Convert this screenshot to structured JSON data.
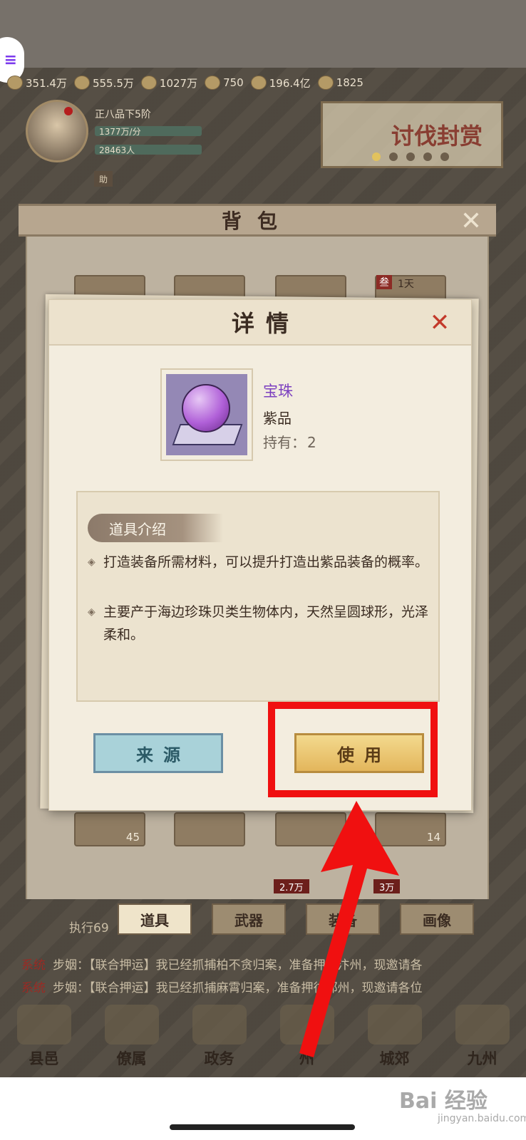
{
  "resources": [
    {
      "icon": "coin-icon",
      "value": "351.4万"
    },
    {
      "icon": "grain-icon",
      "value": "555.5万"
    },
    {
      "icon": "soldier-icon",
      "value": "1027万"
    },
    {
      "icon": "gold-icon",
      "value": "750"
    },
    {
      "icon": "copper-coin-icon",
      "value": "196.4亿"
    },
    {
      "icon": "fame-icon",
      "value": "1825"
    }
  ],
  "player": {
    "rank": "正八品下5阶",
    "income": "1377万/分",
    "population": "28463人",
    "assist_label": "助"
  },
  "event_banner": {
    "text": "讨伐封赏"
  },
  "bag": {
    "title": "背包",
    "slot_tag": "叁",
    "slot_tag_extra": "1天",
    "counts": [
      "45",
      "14"
    ],
    "prices": [
      "2.7万",
      "3万"
    ],
    "tabs": [
      "道具",
      "武器",
      "装备",
      "画像"
    ],
    "exec_text": "执行69"
  },
  "dialog": {
    "title": "详情",
    "item": {
      "name": "宝珠",
      "grade": "紫品",
      "owned_label": "持有：",
      "owned_value": "2"
    },
    "description_header": "道具介绍",
    "description": [
      "打造装备所需材料，可以提升打造出紫品装备的概率。",
      "主要产于海边珍珠贝类生物体内，天然呈圆球形，光泽柔和。"
    ],
    "buttons": {
      "source": "来源",
      "use": "使用"
    }
  },
  "chat": [
    {
      "channel": "系统",
      "text": "步姻：【联合押运】我已经抓捕柏不贪归案，准备押往汴州，现邀请各"
    },
    {
      "channel": "系统",
      "text": "步姻：【联合押运】我已经抓捕麻霄归案，准备押往郑州，现邀请各位"
    }
  ],
  "nav": [
    "县邑",
    "僚属",
    "政务",
    "州",
    "城郊",
    "九州"
  ],
  "watermark": {
    "brand": "Bai 经验",
    "url": "jingyan.baidu.com"
  },
  "colors": {
    "highlight": "#f01010",
    "item_name": "#7b3fbf"
  }
}
